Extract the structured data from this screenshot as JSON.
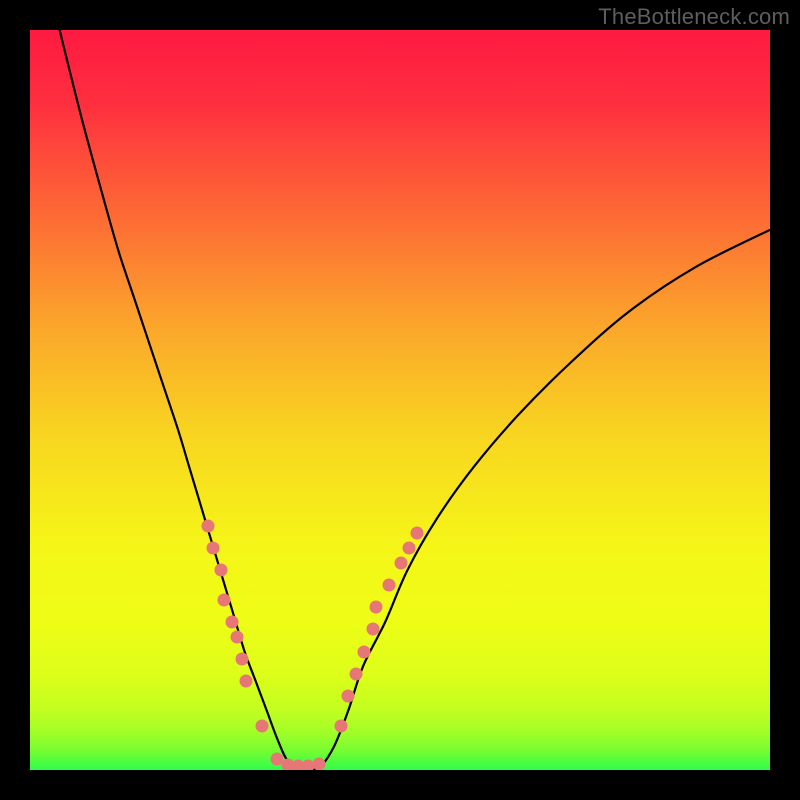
{
  "watermark": "TheBottleneck.com",
  "chart_data": {
    "type": "line",
    "title": "",
    "xlabel": "",
    "ylabel": "",
    "xlim": [
      0,
      100
    ],
    "ylim": [
      0,
      100
    ],
    "gradient_stops": [
      {
        "offset": 0.0,
        "color": "#fe1a41"
      },
      {
        "offset": 0.1,
        "color": "#fe2f3f"
      },
      {
        "offset": 0.25,
        "color": "#fd6a35"
      },
      {
        "offset": 0.4,
        "color": "#fba62b"
      },
      {
        "offset": 0.55,
        "color": "#f8d620"
      },
      {
        "offset": 0.7,
        "color": "#f5f617"
      },
      {
        "offset": 0.8,
        "color": "#eefd16"
      },
      {
        "offset": 0.87,
        "color": "#ddfe19"
      },
      {
        "offset": 0.92,
        "color": "#c1fe20"
      },
      {
        "offset": 0.95,
        "color": "#a0fe28"
      },
      {
        "offset": 0.975,
        "color": "#74fd33"
      },
      {
        "offset": 1.0,
        "color": "#2ffd4b"
      }
    ],
    "series": [
      {
        "name": "bottleneck-curve",
        "x": [
          4,
          7,
          10,
          12,
          14,
          16,
          18,
          20,
          21.5,
          23,
          24.5,
          26,
          27.5,
          29,
          30.5,
          32,
          33.5,
          35,
          37,
          39,
          41,
          43,
          45,
          48,
          51,
          55,
          60,
          66,
          73,
          81,
          90,
          100
        ],
        "y": [
          100,
          88,
          77,
          70,
          64,
          58,
          52,
          46,
          41,
          36,
          31,
          26,
          21,
          16,
          12,
          8,
          4,
          1,
          0.4,
          0.3,
          3,
          8,
          14,
          20,
          27,
          34,
          41,
          48,
          55,
          62,
          68,
          73
        ]
      }
    ],
    "dots": {
      "color": "#e77777",
      "points": [
        {
          "x": 24.0,
          "y": 33
        },
        {
          "x": 24.7,
          "y": 30
        },
        {
          "x": 25.8,
          "y": 27
        },
        {
          "x": 26.2,
          "y": 23
        },
        {
          "x": 27.3,
          "y": 20
        },
        {
          "x": 28.0,
          "y": 18
        },
        {
          "x": 28.6,
          "y": 15
        },
        {
          "x": 29.2,
          "y": 12
        },
        {
          "x": 31.4,
          "y": 6
        },
        {
          "x": 33.4,
          "y": 1.5
        },
        {
          "x": 34.8,
          "y": 0.7
        },
        {
          "x": 36.2,
          "y": 0.5
        },
        {
          "x": 37.6,
          "y": 0.6
        },
        {
          "x": 39.0,
          "y": 0.8
        },
        {
          "x": 42.0,
          "y": 6
        },
        {
          "x": 43.0,
          "y": 10
        },
        {
          "x": 44.0,
          "y": 13
        },
        {
          "x": 45.2,
          "y": 16
        },
        {
          "x": 46.4,
          "y": 19
        },
        {
          "x": 46.7,
          "y": 22
        },
        {
          "x": 48.5,
          "y": 25
        },
        {
          "x": 50.2,
          "y": 28
        },
        {
          "x": 51.2,
          "y": 30
        },
        {
          "x": 52.3,
          "y": 32
        }
      ]
    }
  }
}
